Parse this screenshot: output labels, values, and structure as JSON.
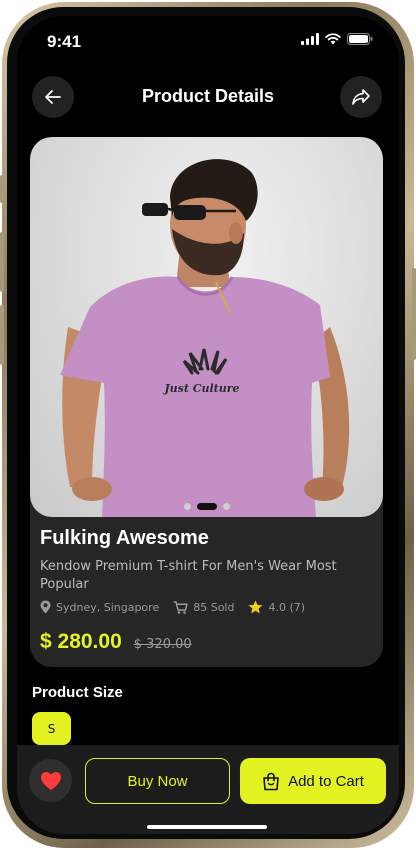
{
  "status_bar": {
    "time": "9:41"
  },
  "header": {
    "title": "Product Details",
    "back_icon": "arrow-left-icon",
    "share_icon": "share-icon"
  },
  "product": {
    "name": "Fulking Awesome",
    "description": "Kendow Premium T-shirt For Men's Wear Most Popular",
    "location": "Sydney, Singapore",
    "sold": "85 Sold",
    "rating": "4.0 (7)",
    "price": "$ 280.00",
    "old_price": "$ 320.00",
    "shirt_print": "Just Culture",
    "image_count": 3,
    "active_image": 2
  },
  "sizes": {
    "title": "Product Size",
    "options": [
      "S"
    ],
    "selected": "S"
  },
  "actions": {
    "buy_label": "Buy Now",
    "cart_label": "Add to Cart"
  },
  "colors": {
    "accent": "#e3f221",
    "background": "#000000",
    "card": "#262626"
  }
}
